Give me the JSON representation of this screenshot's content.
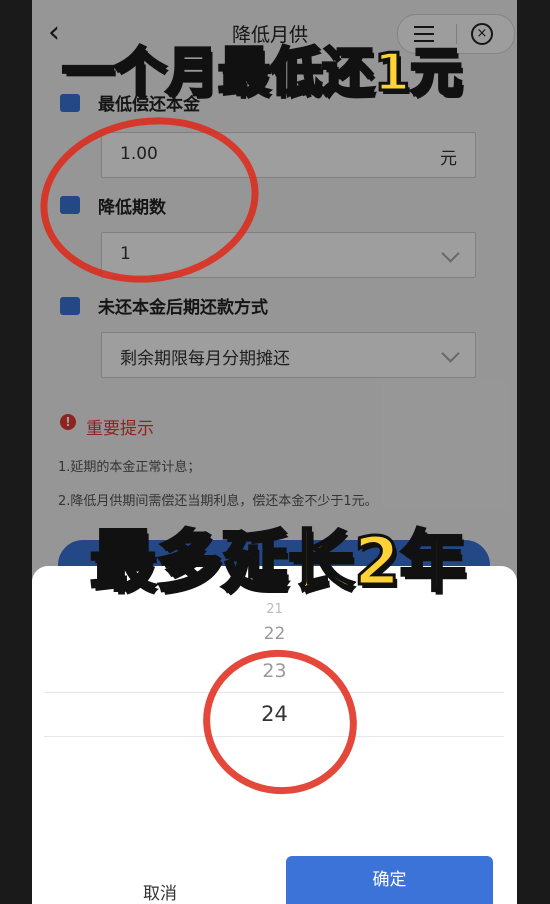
{
  "header": {
    "back_icon": "chevron-left-icon",
    "title": "降低月供"
  },
  "overlay": {
    "caption_top": "一个月最低还1元",
    "caption_mid": "最多延长2年"
  },
  "form": {
    "min_principal": {
      "label": "最低偿还本金",
      "value": "1.00",
      "unit": "元",
      "icon": "wallet-icon"
    },
    "reduce_periods": {
      "label": "降低期数",
      "value": "1",
      "icon": "calendar-icon"
    },
    "repay_method": {
      "label": "未还本金后期还款方式",
      "value": "剩余期限每月分期摊还",
      "icon": "card-icon"
    }
  },
  "notice": {
    "title": "重要提示",
    "items": [
      "1.延期的本金正常计息；",
      "2.降低月供期间需偿还当期利息，偿还本金不少于1元。"
    ]
  },
  "picker": {
    "options": [
      "21",
      "22",
      "23",
      "24"
    ],
    "selected": "24",
    "cancel_label": "取消",
    "confirm_label": "确定"
  },
  "colors": {
    "accent": "#3b73d9",
    "warning": "#e53935",
    "caption": "#ffd335",
    "annotation": "#df2818"
  }
}
